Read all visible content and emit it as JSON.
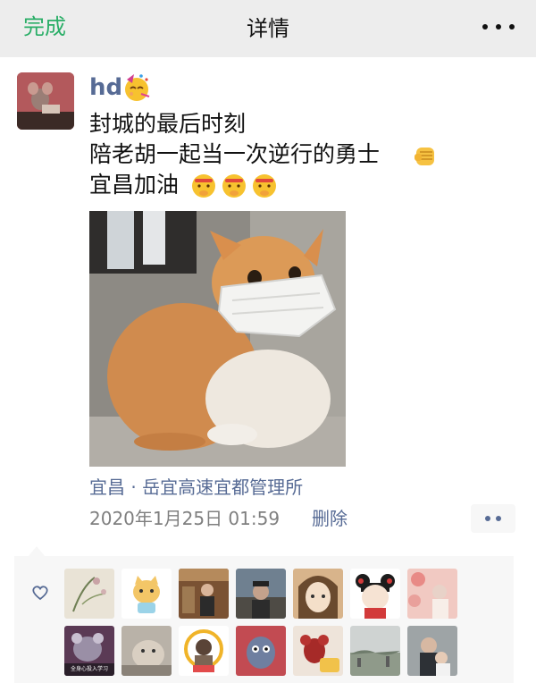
{
  "nav": {
    "done_label": "完成",
    "title": "详情"
  },
  "post": {
    "username": "hd",
    "lines": [
      "封城的最后时刻",
      "陪老胡一起当一次逆行的勇士",
      "宜昌加油"
    ],
    "location": "宜昌 · 岳宜高速宜都管理所",
    "timestamp": "2020年1月25日 01:59",
    "delete_label": "删除"
  },
  "likes": {
    "first_row": [
      "like-avatar-1",
      "like-avatar-2",
      "like-avatar-3",
      "like-avatar-4",
      "like-avatar-5",
      "like-avatar-6",
      "like-avatar-7"
    ],
    "second_row_caption": "全身心投入学习"
  },
  "icons": [
    "more-icon",
    "party-face-icon",
    "fist-icon",
    "shushing-face-icon",
    "heart-icon"
  ],
  "colors": {
    "accent_green": "#2aae67",
    "link_blue": "#576b95",
    "nav_bg": "#ededed",
    "likes_bg": "#f7f7f7"
  }
}
